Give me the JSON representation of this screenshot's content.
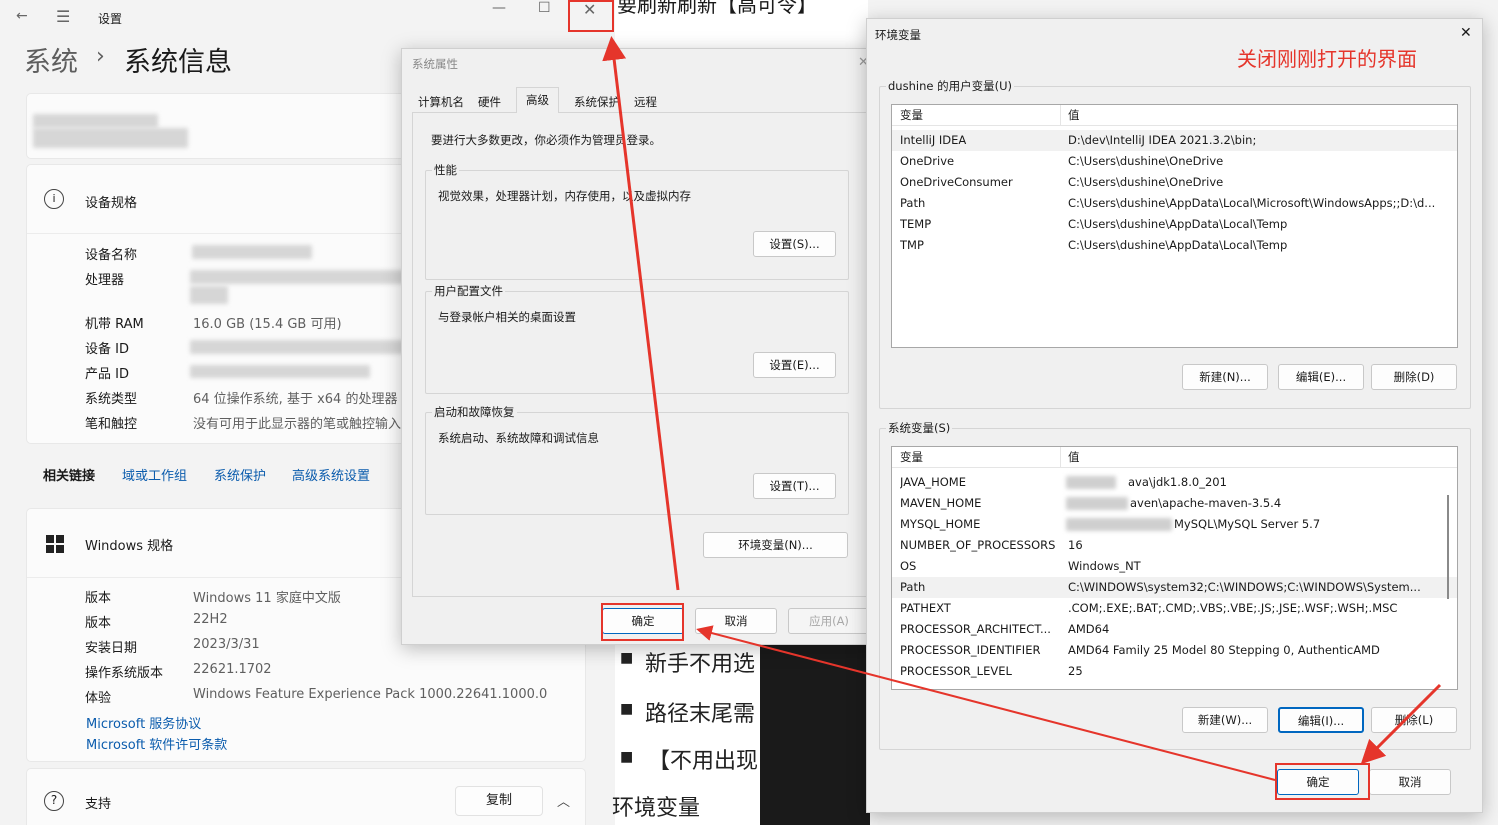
{
  "settings": {
    "window_title": "设置",
    "breadcrumb_parent": "系统",
    "breadcrumb_sep": "›",
    "breadcrumb_current": "系统信息",
    "device_spec_title": "设备规格",
    "specs": [
      {
        "label": "设备名称",
        "value": ""
      },
      {
        "label": "处理器",
        "value": ""
      },
      {
        "label": "机带 RAM",
        "value": "16.0 GB (15.4 GB 可用)"
      },
      {
        "label": "设备 ID",
        "value": ""
      },
      {
        "label": "产品 ID",
        "value": ""
      },
      {
        "label": "系统类型",
        "value": "64 位操作系统, 基于 x64 的处理器"
      },
      {
        "label": "笔和触控",
        "value": "没有可用于此显示器的笔或触控输入"
      }
    ],
    "related_links_label": "相关链接",
    "related_links": [
      "域或工作组",
      "系统保护",
      "高级系统设置"
    ],
    "windows_spec_title": "Windows 规格",
    "win_specs": [
      {
        "label": "版本",
        "value": "Windows 11 家庭中文版"
      },
      {
        "label": "版本",
        "value": "22H2"
      },
      {
        "label": "安装日期",
        "value": "2023/3/31"
      },
      {
        "label": "操作系统版本",
        "value": "22621.1702"
      },
      {
        "label": "体验",
        "value": "Windows Feature Experience Pack 1000.22641.1000.0"
      }
    ],
    "ms_links": [
      "Microsoft 服务协议",
      "Microsoft 软件许可条款"
    ],
    "support_label": "支持",
    "copy_label": "复制"
  },
  "sysprop": {
    "title": "系统属性",
    "tabs": [
      "计算机名",
      "硬件",
      "高级",
      "系统保护",
      "远程"
    ],
    "admin_note": "要进行大多数更改，你必须作为管理员登录。",
    "perf_title": "性能",
    "perf_desc": "视觉效果，处理器计划，内存使用，以及虚拟内存",
    "perf_btn": "设置(S)...",
    "profile_title": "用户配置文件",
    "profile_desc": "与登录帐户相关的桌面设置",
    "profile_btn": "设置(E)...",
    "startup_title": "启动和故障恢复",
    "startup_desc": "系统启动、系统故障和调试信息",
    "startup_btn": "设置(T)...",
    "env_btn": "环境变量(N)...",
    "ok": "确定",
    "cancel": "取消",
    "apply": "应用(A)"
  },
  "background": {
    "top_text": "要刷新刷新【高可令】",
    "bullets": [
      "新手不用选",
      "路径末尾需",
      "【不用出现"
    ],
    "bottom_text": "环境变量"
  },
  "env": {
    "title": "环境变量",
    "annotation": "关闭刚刚打开的界面",
    "user_group": "dushine 的用户变量(U)",
    "col_var": "变量",
    "col_val": "值",
    "user_vars": [
      {
        "name": "IntelliJ IDEA",
        "value": "D:\\dev\\IntelliJ IDEA 2021.3.2\\bin;"
      },
      {
        "name": "OneDrive",
        "value": "C:\\Users\\dushine\\OneDrive"
      },
      {
        "name": "OneDriveConsumer",
        "value": "C:\\Users\\dushine\\OneDrive"
      },
      {
        "name": "Path",
        "value": "C:\\Users\\dushine\\AppData\\Local\\Microsoft\\WindowsApps;;D:\\d..."
      },
      {
        "name": "TEMP",
        "value": "C:\\Users\\dushine\\AppData\\Local\\Temp"
      },
      {
        "name": "TMP",
        "value": "C:\\Users\\dushine\\AppData\\Local\\Temp"
      }
    ],
    "user_new": "新建(N)...",
    "user_edit": "编辑(E)...",
    "user_del": "删除(D)",
    "sys_group": "系统变量(S)",
    "sys_vars": [
      {
        "name": "JAVA_HOME",
        "value": "ava\\jdk1.8.0_201"
      },
      {
        "name": "MAVEN_HOME",
        "value": "aven\\apache-maven-3.5.4"
      },
      {
        "name": "MYSQL_HOME",
        "value": "MySQL\\MySQL Server 5.7"
      },
      {
        "name": "NUMBER_OF_PROCESSORS",
        "value": "16"
      },
      {
        "name": "OS",
        "value": "Windows_NT"
      },
      {
        "name": "Path",
        "value": "C:\\WINDOWS\\system32;C:\\WINDOWS;C:\\WINDOWS\\System..."
      },
      {
        "name": "PATHEXT",
        "value": ".COM;.EXE;.BAT;.CMD;.VBS;.VBE;.JS;.JSE;.WSF;.WSH;.MSC"
      },
      {
        "name": "PROCESSOR_ARCHITECT...",
        "value": "AMD64"
      },
      {
        "name": "PROCESSOR_IDENTIFIER",
        "value": "AMD64 Family 25 Model 80 Stepping 0, AuthenticAMD"
      },
      {
        "name": "PROCESSOR_LEVEL",
        "value": "25"
      }
    ],
    "sys_new": "新建(W)...",
    "sys_edit": "编辑(I)...",
    "sys_del": "删除(L)",
    "ok": "确定",
    "cancel": "取消"
  },
  "colors": {
    "annotation": "#e5352b",
    "link": "#0b5cad"
  }
}
